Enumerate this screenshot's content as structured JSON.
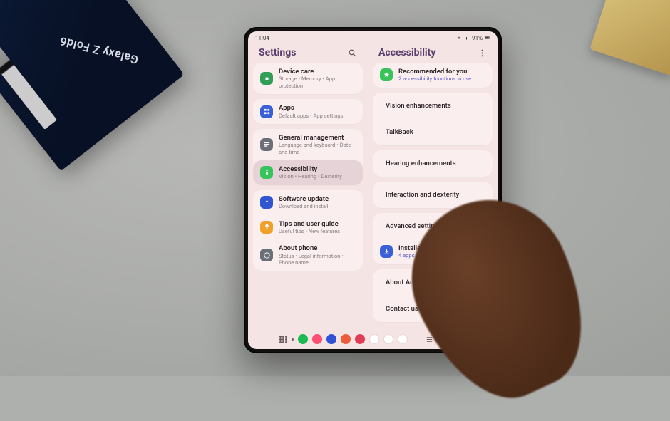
{
  "background": {
    "box_label": "Galaxy Z Fold6"
  },
  "statusbar": {
    "time": "11:04",
    "battery": "91%"
  },
  "left": {
    "title": "Settings",
    "groups": [
      [
        {
          "iconColor": "#2f9e57",
          "title": "Device care",
          "sub": "Storage  •  Memory  •  App protection"
        }
      ],
      [
        {
          "iconColor": "#3a5fd9",
          "title": "Apps",
          "sub": "Default apps  •  App settings"
        }
      ],
      [
        {
          "iconColor": "#6b6f78",
          "title": "General management",
          "sub": "Language and keyboard  •  Date and time"
        },
        {
          "iconColor": "#37c45a",
          "title": "Accessibility",
          "sub": "Vision  •  Hearing  •  Dexterity",
          "selected": true
        }
      ],
      [
        {
          "iconColor": "#2f55d0",
          "title": "Software update",
          "sub": "Download and install"
        },
        {
          "iconColor": "#f0a12b",
          "title": "Tips and user guide",
          "sub": "Useful tips  •  New features"
        },
        {
          "iconColor": "#6b6f78",
          "title": "About phone",
          "sub": "Status  •  Legal information  •  Phone name"
        }
      ]
    ]
  },
  "right": {
    "title": "Accessibility",
    "groups": [
      [
        {
          "iconColor": "#37c45a",
          "title": "Recommended for you",
          "sub": "2 accessibility functions in use",
          "subAccent": true
        }
      ],
      [
        {
          "iconColor": "#3a5fd9",
          "title": "Vision enhancements"
        },
        {
          "iconColor": "#3a5fd9",
          "title": "TalkBack"
        }
      ],
      [
        {
          "iconColor": "#2f9e57",
          "title": "Hearing enhancements"
        }
      ],
      [
        {
          "iconColor": "#cf3b3b",
          "title": "Interaction and dexterity"
        }
      ],
      [
        {
          "iconColor": "#3a5fd9",
          "title": "Advanced settings"
        },
        {
          "iconColor": "#3a5fd9",
          "title": "Installed apps",
          "sub": "4 apps",
          "subAccent": true
        }
      ],
      [
        {
          "iconColor": "#4a4e9e",
          "title": "About Accessibility"
        },
        {
          "iconColor": "#4a4e9e",
          "title": "Contact us"
        }
      ]
    ]
  },
  "taskbar": {
    "apps": [
      {
        "name": "phone",
        "color": "#1db954"
      },
      {
        "name": "samsung-health",
        "color": "#ff4e73"
      },
      {
        "name": "bixby",
        "color": "#3152d6"
      },
      {
        "name": "notes",
        "color": "#ef5b3d"
      },
      {
        "name": "gallery",
        "color": "#e23b57"
      },
      {
        "name": "youtube",
        "color": "#ffffff"
      },
      {
        "name": "play-store",
        "color": "#ffffff"
      },
      {
        "name": "chrome",
        "color": "#ffffff"
      }
    ]
  }
}
